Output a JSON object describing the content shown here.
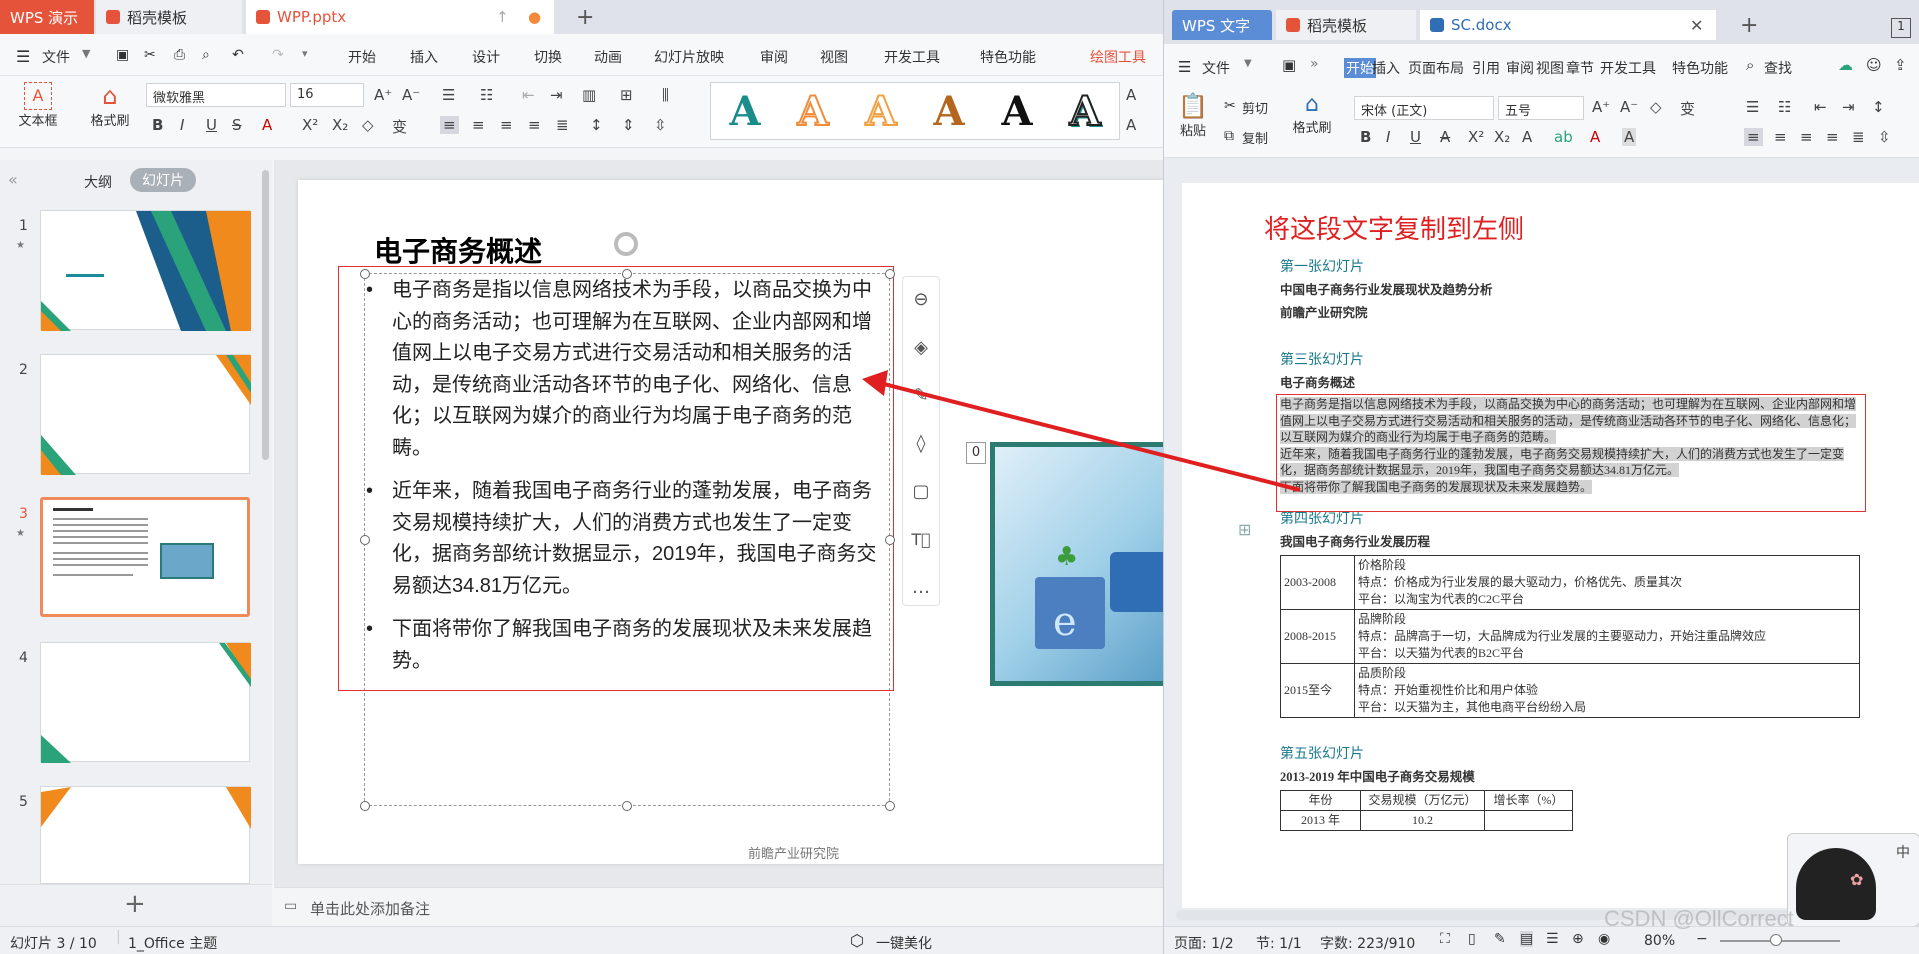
{
  "left": {
    "tabs": {
      "app": "WPS 演示",
      "template": "稻壳模板",
      "file": "WPP.pptx"
    },
    "menu": {
      "file": "文件",
      "items": [
        "开始",
        "插入",
        "设计",
        "切换",
        "动画",
        "幻灯片放映",
        "审阅",
        "视图",
        "开发工具",
        "特色功能"
      ],
      "active": "绘图工具"
    },
    "ribbon": {
      "textbox": "文本框",
      "format_painter": "格式刷",
      "font": "微软雅黑",
      "size": "16",
      "style_letter": "A"
    },
    "panel": {
      "outline": "大纲",
      "slides": "幻灯片",
      "numbers": [
        "1",
        "2",
        "3",
        "4",
        "5"
      ]
    },
    "slide": {
      "title": "电子商务概述",
      "bullets": [
        "电子商务是指以信息网络技术为手段，以商品交换为中心的商务活动；也可理解为在互联网、企业内部网和增值网上以电子交易方式进行交易活动和相关服务的活动，是传统商业活动各环节的电子化、网络化、信息化；以互联网为媒介的商业行为均属于电子商务的范畴。",
        "近年来，随着我国电子商务行业的蓬勃发展，电子商务交易规模持续扩大，人们的消费方式也发生了一定变化，据商务部统计数据显示，2019年，我国电子商务交易额达34.81万亿元。",
        "下面将带你了解我国电子商务的发展现状及未来发展趋势。"
      ],
      "footer": "前瞻产业研究院",
      "image_badge": "0"
    },
    "notes": "单击此处添加备注",
    "status": {
      "page": "幻灯片 3 / 10",
      "theme": "1_Office 主题",
      "beautify": "一键美化"
    }
  },
  "right": {
    "tabs": {
      "app": "WPS 文字",
      "template": "稻壳模板",
      "file": "SC.docx"
    },
    "menu": {
      "file": "文件",
      "items": [
        "开始",
        "插入",
        "页面布局",
        "引用",
        "审阅",
        "视图",
        "章节",
        "开发工具",
        "特色功能"
      ],
      "search": "查找"
    },
    "ribbon": {
      "paste": "粘贴",
      "cut": "剪切",
      "copy": "复制",
      "painter": "格式刷",
      "font": "宋体 (正文)",
      "size": "五号"
    },
    "annotation": "将这段文字复制到左侧",
    "doc": {
      "s1_head": "第一张幻灯片",
      "s1_line1": "中国电子商务行业发展现状及趋势分析",
      "s1_line2": "前瞻产业研究院",
      "s3_head": "第三张幻灯片",
      "s3_title": "电子商务概述",
      "s3_p1": "电子商务是指以信息网络技术为手段，以商品交换为中心的商务活动；也可理解为在互联网、企业内部网和增值网上以电子交易方式进行交易活动和相关服务的活动，是传统商业活动各环节的电子化、网络化、信息化；以互联网为媒介的商业行为均属于电子商务的范畴。",
      "s3_p2": "近年来，随着我国电子商务行业的蓬勃发展，电子商务交易规模持续扩大，人们的消费方式也发生了一定变化，据商务部统计数据显示，2019年，我国电子商务交易额达34.81万亿元。",
      "s3_p3": "下面将带你了解我国电子商务的发展现状及未来发展趋势。",
      "s4_head": "第四张幻灯片",
      "s4_title": "我国电子商务行业发展历程",
      "s4_rows": [
        {
          "period": "2003-2008",
          "l1": "价格阶段",
          "l2": "特点：价格成为行业发展的最大驱动力，价格优先、质量其次",
          "l3": "平台：以淘宝为代表的C2C平台"
        },
        {
          "period": "2008-2015",
          "l1": "品牌阶段",
          "l2": "特点：品牌高于一切，大品牌成为行业发展的主要驱动力，开始注重品牌效应",
          "l3": "平台：以天猫为代表的B2C平台"
        },
        {
          "period": "2015至今",
          "l1": "品质阶段",
          "l2": "特点：开始重视性价比和用户体验",
          "l3": "平台：以天猫为主，其他电商平台纷纷入局"
        }
      ],
      "s5_head": "第五张幻灯片",
      "s5_title": "2013-2019 年中国电子商务交易规模",
      "s5_cols": [
        "年份",
        "交易规模（万亿元）",
        "增长率（%）"
      ],
      "s5_row": [
        "2013 年",
        "10.2",
        ""
      ]
    },
    "status": {
      "page": "页面: 1/2",
      "section": "节: 1/1",
      "words": "字数: 223/910",
      "zoom": "80%"
    },
    "watermark": "CSDN @OllCorrect"
  }
}
